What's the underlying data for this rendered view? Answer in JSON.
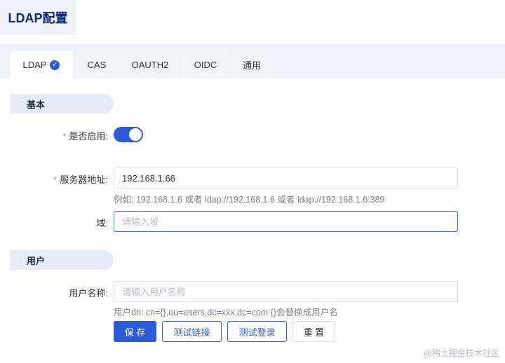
{
  "page": {
    "title": "LDAP配置"
  },
  "tabs": [
    {
      "label": "LDAP",
      "active": true
    },
    {
      "label": "CAS"
    },
    {
      "label": "OAUTH2"
    },
    {
      "label": "OIDC"
    },
    {
      "label": "通用"
    }
  ],
  "tab_check_icon": "check-circle-icon",
  "basic": {
    "header": "基本",
    "enabled": {
      "required_mark": "*",
      "label": "是否启用:",
      "value": true
    },
    "server": {
      "required_mark": "*",
      "label": "服务器地址:",
      "value": "192.168.1.66",
      "hint": "例如: 192.168.1.6 或者 ldap://192.168.1.6 或者 ldap://192.168.1.6:389"
    },
    "domain": {
      "label": "域:",
      "placeholder": "请输入域",
      "value": ""
    }
  },
  "user": {
    "header": "用户",
    "username": {
      "label": "用户名称:",
      "placeholder": "请输入用户名称",
      "value": "",
      "hint": "用户dn: cn={},ou=users,dc=xxx,dc=com {}会替换成用户名"
    }
  },
  "buttons": {
    "save": "保 存",
    "test_link": "测试链接",
    "test_login": "测试登录",
    "reset": "重 置"
  },
  "colors": {
    "primary": "#2d5bd6",
    "required": "#f56c6c"
  },
  "watermark": "@稀土掘金技术社区"
}
